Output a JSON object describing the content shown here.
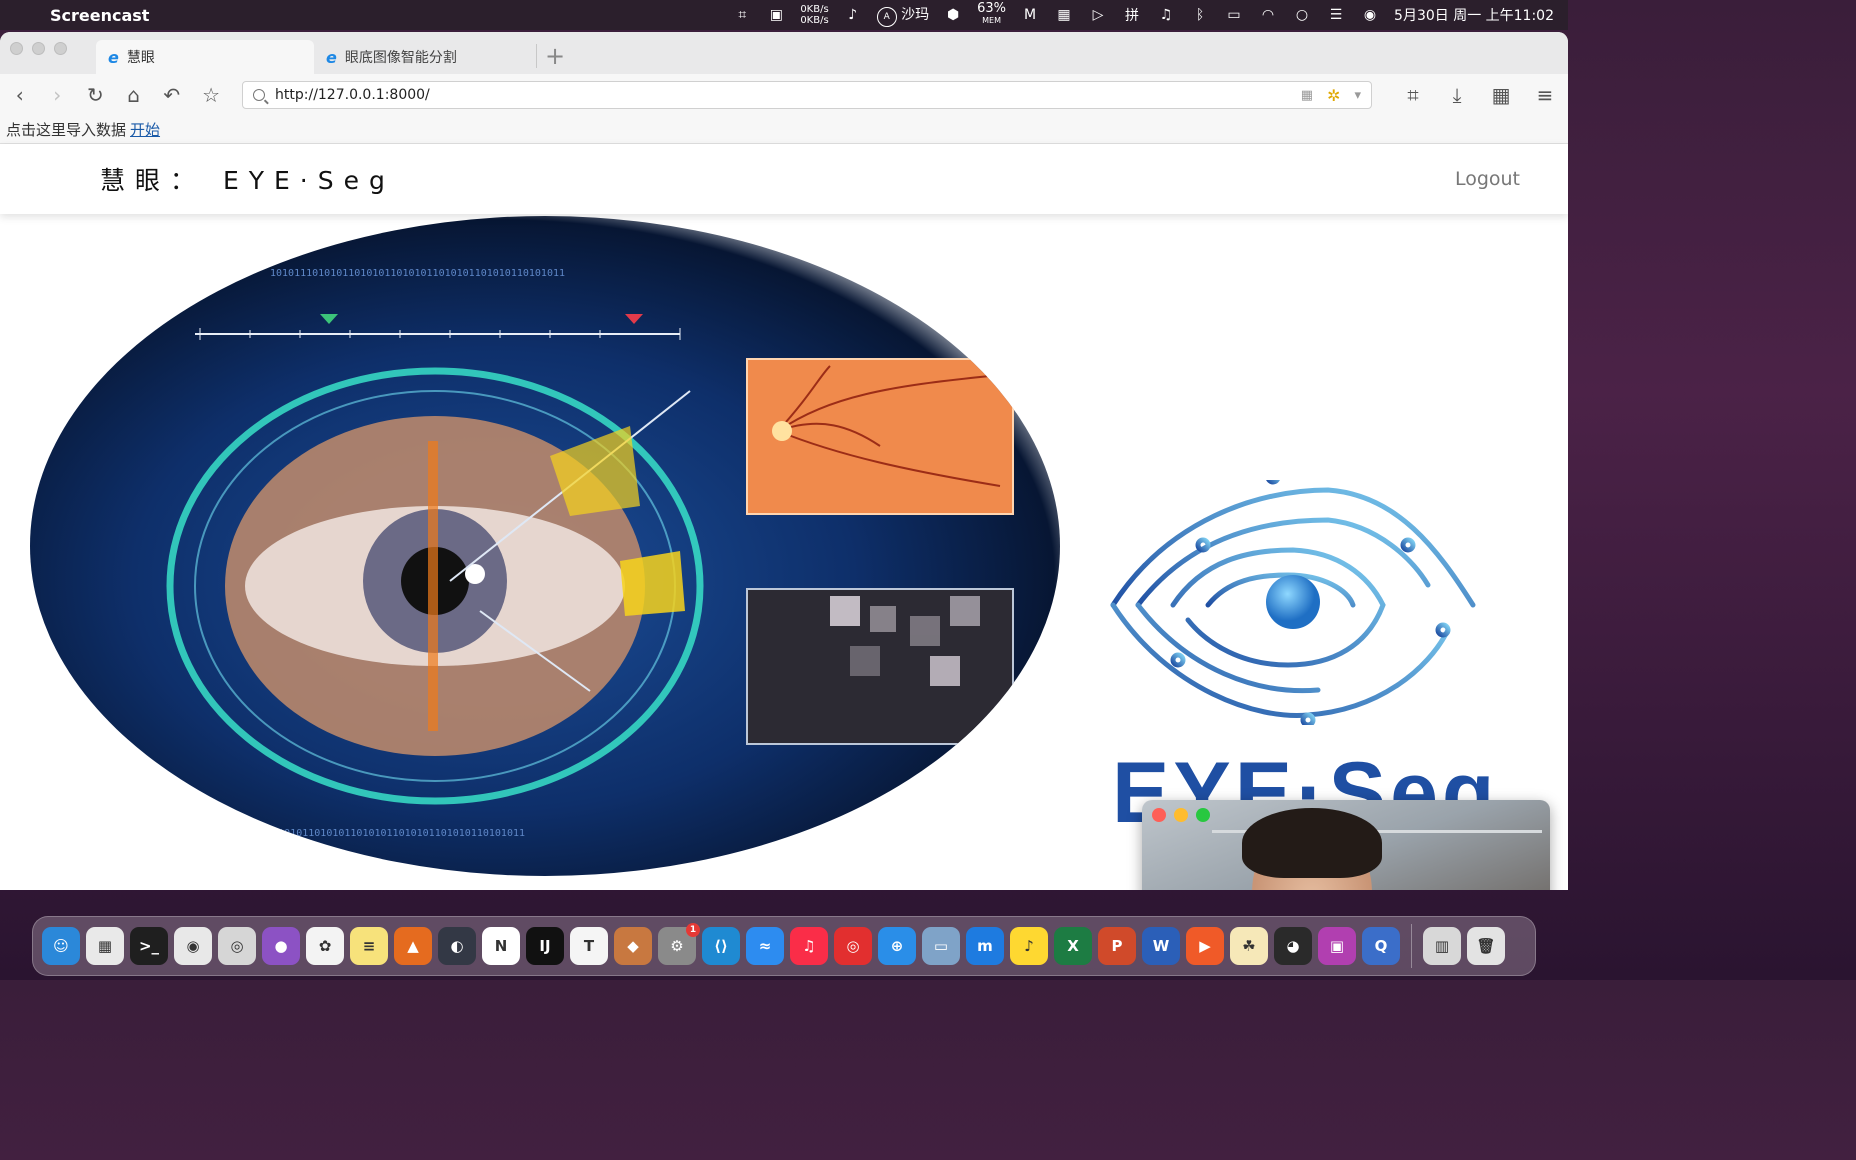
{
  "menubar": {
    "app_name": "Screencast",
    "net_up": "0KB/s",
    "net_down": "0KB/s",
    "shortcut_label": "沙玛",
    "mem_value": "63%",
    "mem_label": "MEM",
    "ime": "拼",
    "datetime": "5月30日 周一 上午11:02"
  },
  "browser": {
    "tabs": [
      {
        "label": "慧眼",
        "active": true
      },
      {
        "label": "眼底图像智能分割",
        "active": false
      }
    ],
    "url": "http://127.0.0.1:8000/",
    "bookmark_text": "点击这里导入数据",
    "bookmark_link": "开始"
  },
  "page": {
    "brand": "慧眼： EYE·Seg",
    "logout": "Logout",
    "logo_text": "EYE·Seg",
    "hero_binary": "1010111010101101010110101011010101101010110101011"
  },
  "colors": {
    "accent_blue": "#1f4fa3",
    "logo_light_blue": "#3aa0dd",
    "cam_red": "#fe5f57",
    "cam_yellow": "#febc2e",
    "cam_green": "#28c840"
  },
  "dock": {
    "items": [
      {
        "name": "finder-icon",
        "glyph": "☺",
        "bg": "#2b88d9"
      },
      {
        "name": "launchpad-icon",
        "glyph": "▦",
        "bg": "#e9e9e9"
      },
      {
        "name": "terminal-icon",
        "glyph": ">_",
        "bg": "#1f1f1f"
      },
      {
        "name": "chrome-icon",
        "glyph": "◉",
        "bg": "#e8e8e8"
      },
      {
        "name": "screenshot-icon",
        "glyph": "◎",
        "bg": "#d6d6d6"
      },
      {
        "name": "github-icon",
        "glyph": "●",
        "bg": "#8c52c4"
      },
      {
        "name": "photos-icon",
        "glyph": "✿",
        "bg": "#f3f3f3"
      },
      {
        "name": "notes-icon",
        "glyph": "≡",
        "bg": "#f7e27b"
      },
      {
        "name": "matlab-icon",
        "glyph": "▲",
        "bg": "#e56b1f"
      },
      {
        "name": "obs-icon",
        "glyph": "◐",
        "bg": "#333845"
      },
      {
        "name": "notion-icon",
        "glyph": "N",
        "bg": "#ffffff"
      },
      {
        "name": "intellij-icon",
        "glyph": "IJ",
        "bg": "#111111"
      },
      {
        "name": "typora-icon",
        "glyph": "T",
        "bg": "#f5f5f5"
      },
      {
        "name": "parallels-icon",
        "glyph": "◆",
        "bg": "#c87840"
      },
      {
        "name": "system-preferences-icon",
        "glyph": "⚙",
        "bg": "#8a8a8a",
        "badge": "1"
      },
      {
        "name": "vscode-icon",
        "glyph": "⟨⟩",
        "bg": "#1f8ad2"
      },
      {
        "name": "xmind-icon",
        "glyph": "≈",
        "bg": "#2d8cf0"
      },
      {
        "name": "music-icon",
        "glyph": "♫",
        "bg": "#fa2d48"
      },
      {
        "name": "netease-music-icon",
        "glyph": "◎",
        "bg": "#e22f2f"
      },
      {
        "name": "safari-icon",
        "glyph": "⊕",
        "bg": "#2a8ee8"
      },
      {
        "name": "preview-icon",
        "glyph": "▭",
        "bg": "#7fa3c8"
      },
      {
        "name": "maxthon-icon",
        "glyph": "m",
        "bg": "#1e7be0"
      },
      {
        "name": "qq-music-icon",
        "glyph": "♪",
        "bg": "#fed831"
      },
      {
        "name": "excel-icon",
        "glyph": "X",
        "bg": "#1d7c43"
      },
      {
        "name": "powerpoint-icon",
        "glyph": "P",
        "bg": "#d04a2a"
      },
      {
        "name": "word-icon",
        "glyph": "W",
        "bg": "#2b5fb8"
      },
      {
        "name": "infuse-icon",
        "glyph": "▶",
        "bg": "#f05a28"
      },
      {
        "name": "paw-icon",
        "glyph": "☘",
        "bg": "#f6e8b8"
      },
      {
        "name": "qq-icon",
        "glyph": "◕",
        "bg": "#2a2a2a"
      },
      {
        "name": "screen-recorder-icon",
        "glyph": "▣",
        "bg": "#b13fb0"
      },
      {
        "name": "quicktime-icon",
        "glyph": "Q",
        "bg": "#3b6ec9"
      }
    ],
    "trailing": [
      {
        "name": "archive-icon",
        "glyph": "▥",
        "bg": "#d8d8d8"
      },
      {
        "name": "trash-icon",
        "glyph": "🗑",
        "bg": "#e3e3e3"
      }
    ]
  }
}
